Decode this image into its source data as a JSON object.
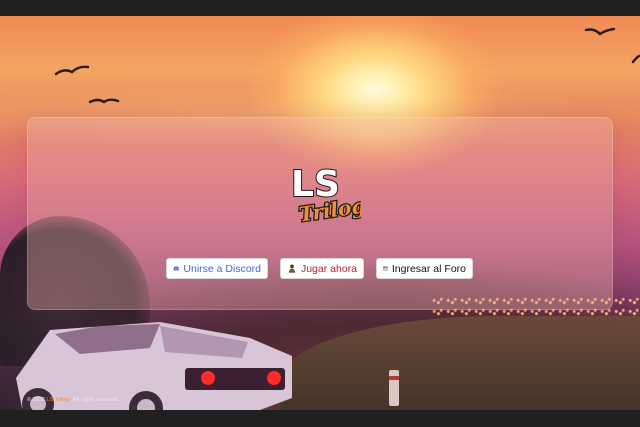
{
  "brand": {
    "logo_line1": "LS",
    "logo_line2": "Trilogy"
  },
  "buttons": {
    "discord": {
      "label": "Unirse a Discord",
      "icon": "discord-icon",
      "color": "#3f66e6"
    },
    "play": {
      "label": "Jugar ahora",
      "icon": "game-character-icon",
      "color": "#b3282d"
    },
    "forum": {
      "label": "Ingresar al Foro",
      "icon": "browser-window-icon",
      "color": "#111111"
    }
  },
  "footer": {
    "prefix": "© 2022 ",
    "brand": "LS Trilogy",
    "suffix": ". All rights reserved.",
    "brand_color": "#f2903a"
  },
  "colors": {
    "background_bar": "#1f2121",
    "accent": "#f2903a"
  }
}
